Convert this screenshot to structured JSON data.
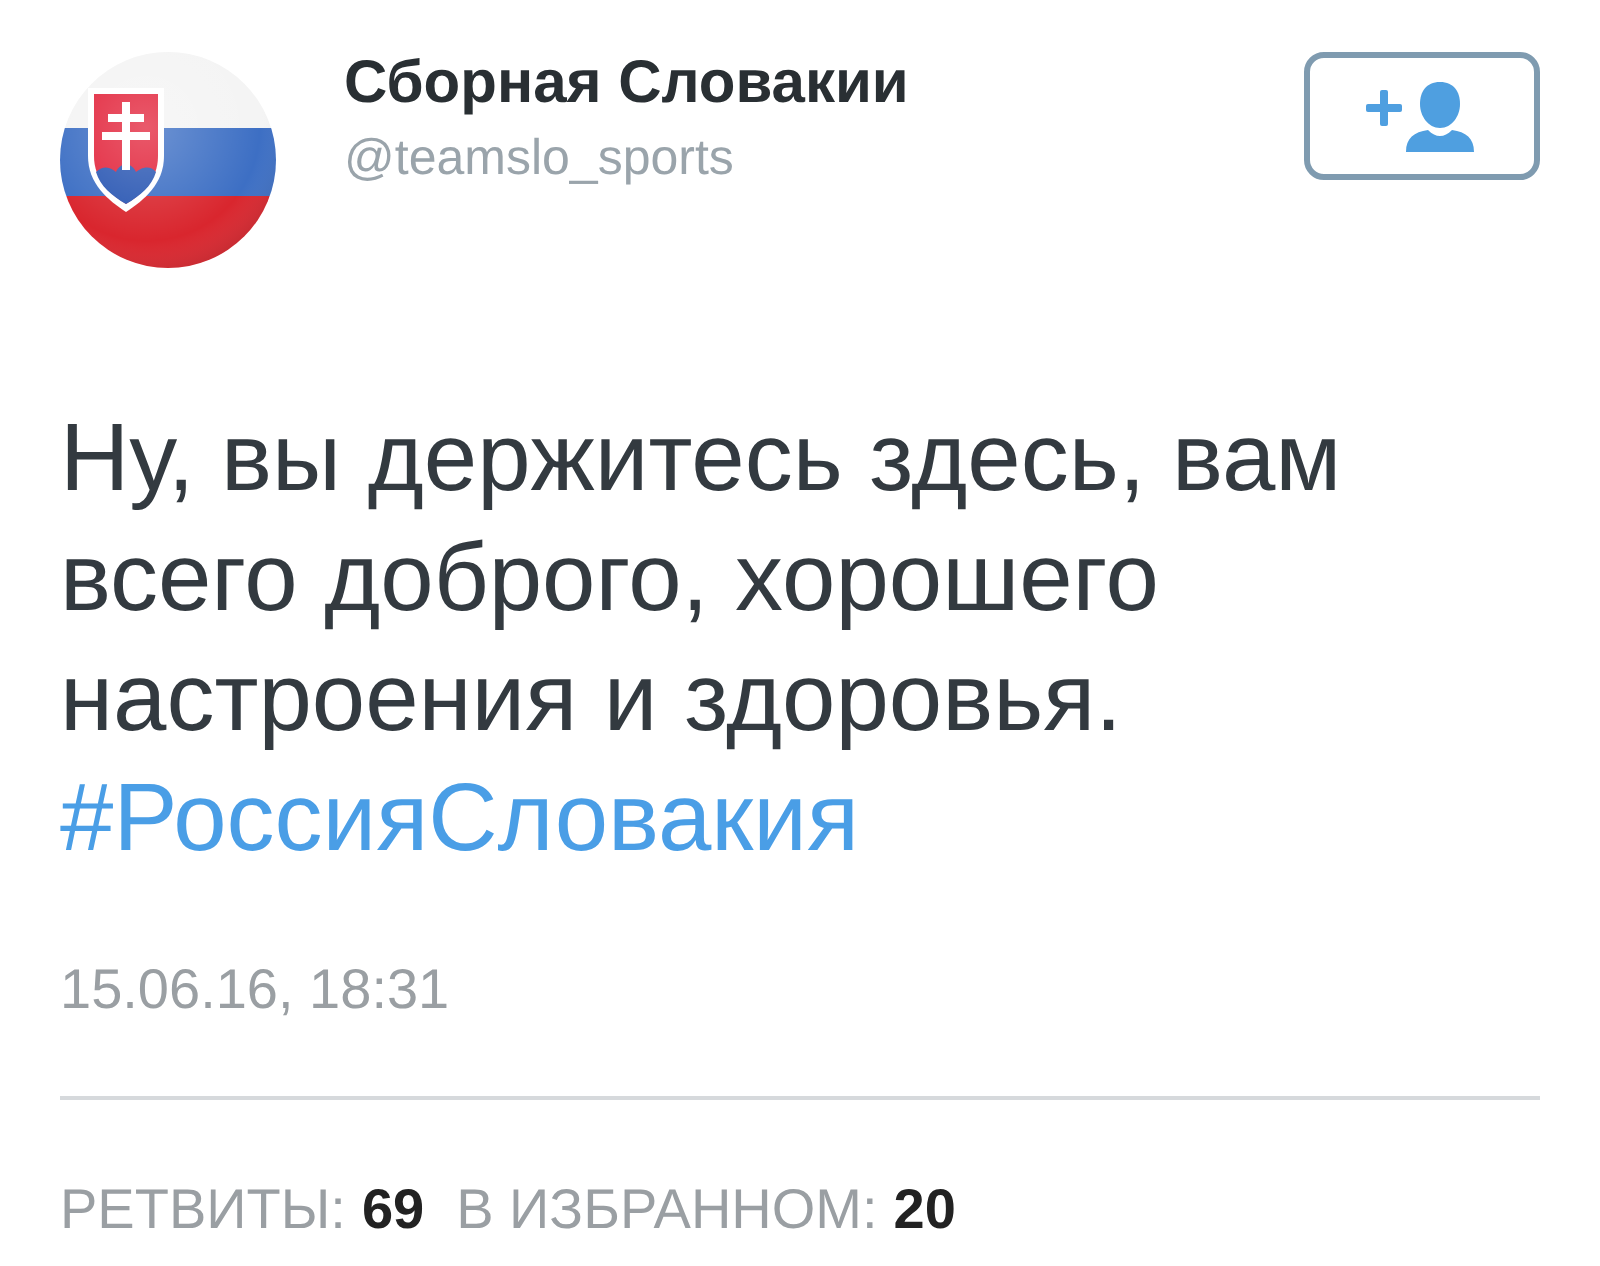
{
  "author": {
    "name": "Сборная Словакии",
    "handle": "@teamslo_sports"
  },
  "tweet": {
    "text": "Ну, вы держитесь здесь, вам всего доброго, хорошего настроения и здоровья.",
    "hashtag": "#РоссияСловакия",
    "timestamp": "15.06.16, 18:31"
  },
  "stats": [
    {
      "label": "РЕТВИТЫ:",
      "value": "69"
    },
    {
      "label": "В ИЗБРАННОМ:",
      "value": "20"
    }
  ]
}
